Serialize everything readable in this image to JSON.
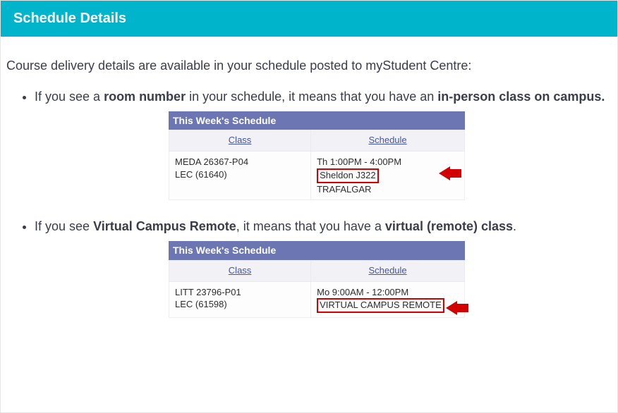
{
  "header": {
    "title": "Schedule Details"
  },
  "intro": "Course delivery details are available in your schedule posted to myStudent Centre:",
  "bullets": [
    {
      "pre": "If you see a ",
      "b1": "room number",
      "mid": " in your schedule, it means that you have an ",
      "b2": "in-person class on campus.",
      "post": ""
    },
    {
      "pre": "If you see ",
      "b1": "Virtual Campus Remote",
      "mid": ", it means that you have a ",
      "b2": "virtual (remote) class",
      "post": "."
    }
  ],
  "schedule_widgets": [
    {
      "title": "This Week's Schedule",
      "col_class": "Class",
      "col_sched": "Schedule",
      "course_line1": "MEDA 26367-P04",
      "course_line2": "LEC (61640)",
      "time": "Th 1:00PM - 4:00PM",
      "highlight": "Sheldon J322",
      "after": "TRAFALGAR"
    },
    {
      "title": "This Week's Schedule",
      "col_class": "Class",
      "col_sched": "Schedule",
      "course_line1": "LITT 23796-P01",
      "course_line2": "LEC (61598)",
      "time": "Mo 9:00AM - 12:00PM",
      "highlight": "VIRTUAL CAMPUS REMOTE",
      "after": ""
    }
  ]
}
